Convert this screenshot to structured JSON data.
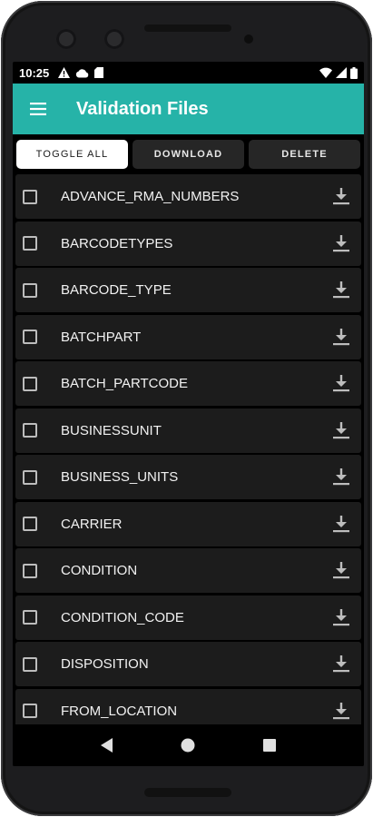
{
  "status_bar": {
    "time": "10:25",
    "icons_left": [
      "warning-icon",
      "cloud-icon",
      "sd-card-icon"
    ],
    "icons_right": [
      "wifi-icon",
      "signal-icon",
      "battery-icon"
    ]
  },
  "app_bar": {
    "title": "Validation Files",
    "menu_icon": "hamburger-menu-icon",
    "color": "#26b3a8"
  },
  "toolbar": {
    "toggle_all": "TOGGLE ALL",
    "download": "DOWNLOAD",
    "delete": "DELETE"
  },
  "files": [
    {
      "name": "ADVANCE_RMA_NUMBERS",
      "checked": false
    },
    {
      "name": "BARCODETYPES",
      "checked": false
    },
    {
      "name": "BARCODE_TYPE",
      "checked": false
    },
    {
      "name": "BATCHPART",
      "checked": false
    },
    {
      "name": "BATCH_PARTCODE",
      "checked": false
    },
    {
      "name": "BUSINESSUNIT",
      "checked": false
    },
    {
      "name": "BUSINESS_UNITS",
      "checked": false
    },
    {
      "name": "CARRIER",
      "checked": false
    },
    {
      "name": "CONDITION",
      "checked": false
    },
    {
      "name": "CONDITION_CODE",
      "checked": false
    },
    {
      "name": "DISPOSITION",
      "checked": false
    },
    {
      "name": "FROM_LOCATION",
      "checked": false
    }
  ],
  "nav_bar": {
    "icons": [
      "back-icon",
      "home-icon",
      "recents-icon"
    ]
  }
}
